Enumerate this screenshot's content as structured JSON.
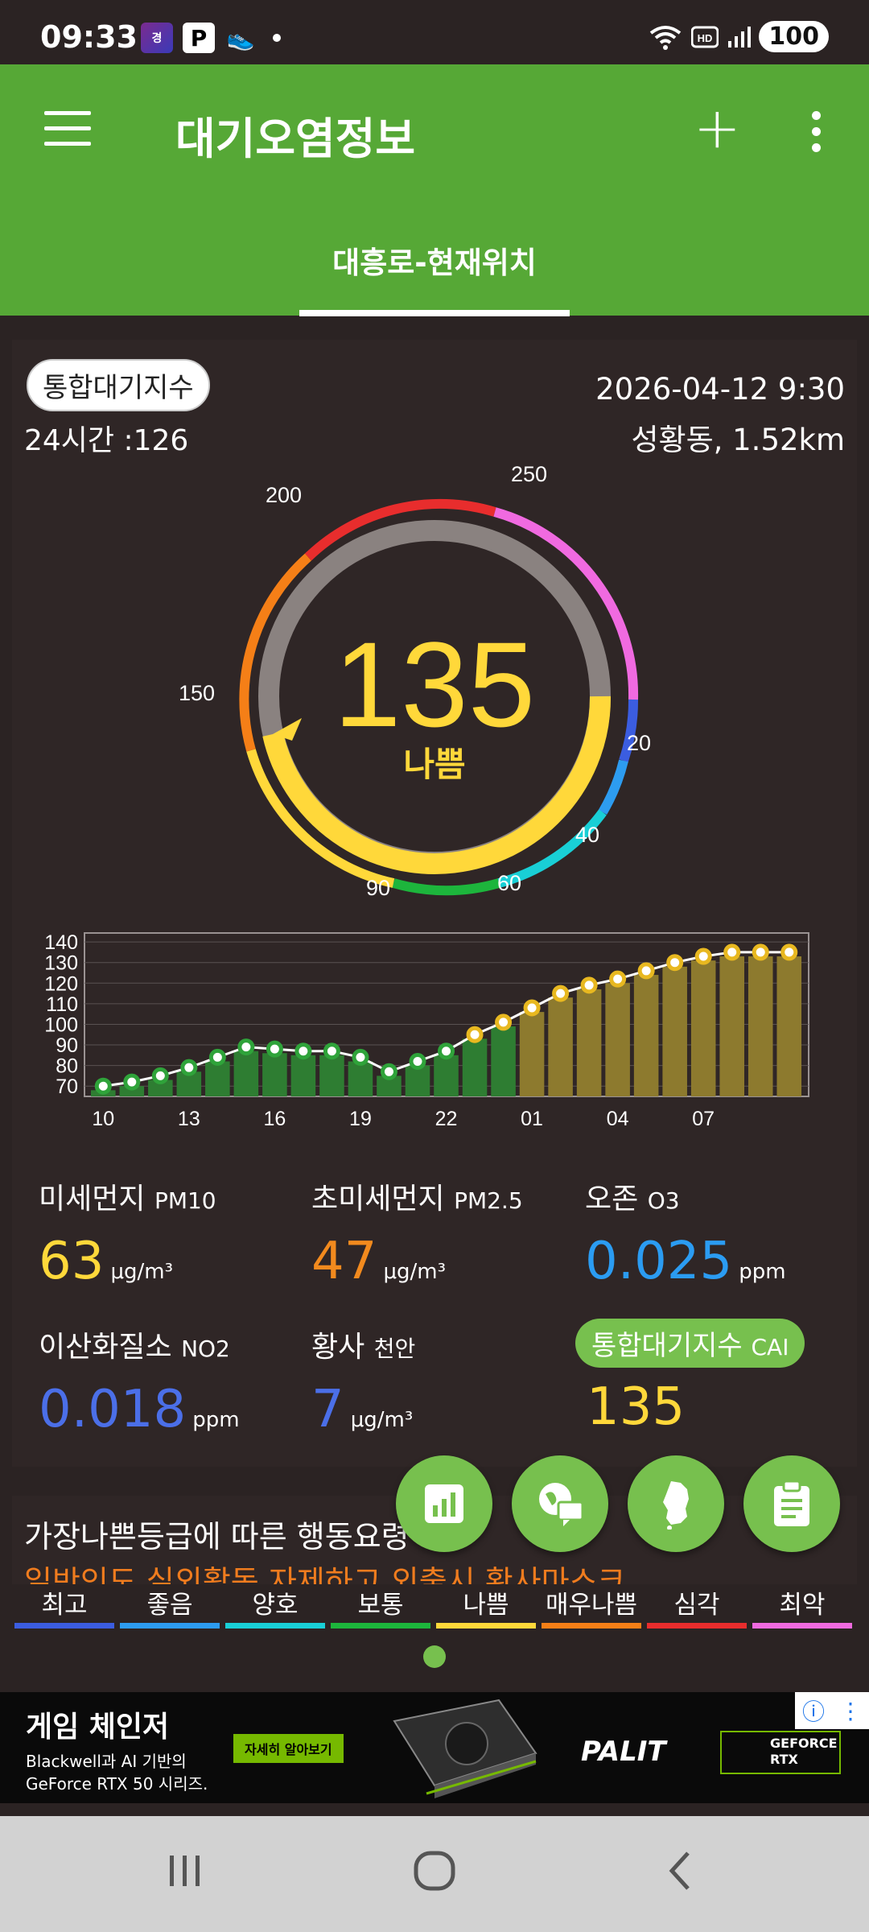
{
  "status_bar": {
    "time": "09:33",
    "battery": "100",
    "icons_left": [
      "app-icon",
      "parking-icon",
      "shoe-icon",
      "notification-dot"
    ],
    "icons_right": [
      "wifi-icon",
      "hd-icon",
      "signal-icon",
      "battery-icon"
    ]
  },
  "app_bar": {
    "title": "대기오염정보",
    "tab": "대흥로-현재위치",
    "colors": {
      "background": "#56a836"
    }
  },
  "summary": {
    "chip": "통합대기지수",
    "avg24": "24시간 :126",
    "datetime": "2026-04-12 9:30",
    "station": "성황동, 1.52km"
  },
  "gauge": {
    "value": "135",
    "grade": "나쁨",
    "value_color": "#ffd83a",
    "tick_labels": [
      "250",
      "200",
      "150",
      "20",
      "40",
      "60",
      "90"
    ]
  },
  "chart_data": {
    "type": "bar",
    "x_tick_labels": [
      "10",
      "13",
      "16",
      "19",
      "22",
      "01",
      "04",
      "07"
    ],
    "y_tick_labels": [
      "140",
      "130",
      "120",
      "110",
      "100",
      "90",
      "80",
      "70"
    ],
    "ylim": [
      65,
      142
    ],
    "series": [
      {
        "values": [
          70,
          72,
          75,
          79,
          84,
          89,
          88,
          87,
          87,
          84,
          77,
          82,
          87,
          95,
          101,
          108,
          115,
          119,
          122,
          126,
          130,
          133,
          135,
          135,
          135
        ]
      }
    ]
  },
  "pollutants": {
    "pm10": {
      "name": "미세먼지",
      "tag": "PM10",
      "value": "63",
      "unit": "μg/m³",
      "color": "#ffd83a"
    },
    "pm25": {
      "name": "초미세먼지",
      "tag": "PM2.5",
      "value": "47",
      "unit": "μg/m³",
      "color": "#f28a1e"
    },
    "o3": {
      "name": "오존",
      "tag": "O3",
      "value": "0.025",
      "unit": "ppm",
      "color": "#2b9cf2"
    },
    "no2": {
      "name": "이산화질소",
      "tag": "NO2",
      "value": "0.018",
      "unit": "ppm",
      "color": "#4b6fe8"
    },
    "dust": {
      "name": "황사",
      "tag": "천안",
      "value": "7",
      "unit": "μg/m³",
      "color": "#4b6fe8"
    },
    "cai": {
      "name": "통합대기지수",
      "tag": "CAI",
      "value": "135",
      "color": "#ffd83a"
    }
  },
  "action": {
    "title": "가장나쁜등급에 따른 행동요령",
    "text": "일반인도 실외활동 자제하고 외출시 황사마스크"
  },
  "fabs": [
    "chart-icon",
    "map-chat-icon",
    "korea-map-icon",
    "clipboard-icon"
  ],
  "legend": [
    {
      "label": "최고",
      "color": "#3b5de0"
    },
    {
      "label": "좋음",
      "color": "#2d9cf0"
    },
    {
      "label": "양호",
      "color": "#19cfd6"
    },
    {
      "label": "보통",
      "color": "#1db53c"
    },
    {
      "label": "나쁨",
      "color": "#ffd83a"
    },
    {
      "label": "매우나쁨",
      "color": "#f57f17"
    },
    {
      "label": "심각",
      "color": "#e82d2d"
    },
    {
      "label": "최악",
      "color": "#f06ae0"
    }
  ],
  "ad": {
    "title": "게임 체인저",
    "sub1": "Blackwell과 AI 기반의",
    "sub2": "GeForce RTX 50 시리즈.",
    "button": "자세히 알아보기",
    "brand": "PALIT",
    "geforce1": "GEFORCE",
    "geforce2": "RTX"
  }
}
